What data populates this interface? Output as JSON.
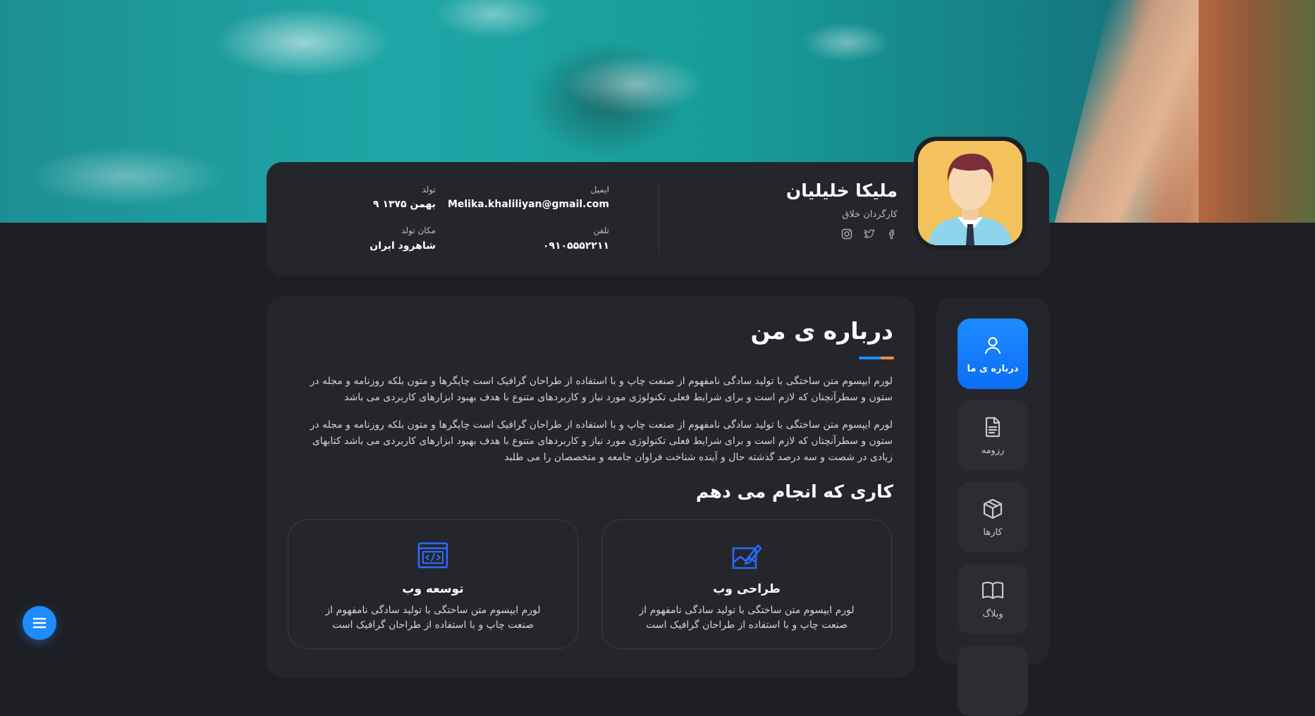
{
  "profile": {
    "name": "ملیکا خلیلیان",
    "role": "کارگردان خلاق",
    "socials": [
      "facebook-icon",
      "twitter-icon",
      "instagram-icon"
    ]
  },
  "info": {
    "email_label": "ایمیل",
    "email_value": "Melika.khaliliyan@gmail.com",
    "birth_label": "تولد",
    "birth_value": "۹ بهمن ۱۳۷۵",
    "phone_label": "تلفن",
    "phone_value": "۰۹۱۰۵۵۵۲۲۱۱",
    "birthplace_label": "مکان تولد",
    "birthplace_value": "شاهرود ایران"
  },
  "nav": {
    "items": [
      {
        "label": "درباره ی ما",
        "icon": "user-icon"
      },
      {
        "label": "رزومه",
        "icon": "document-icon"
      },
      {
        "label": "کارها",
        "icon": "box-icon"
      },
      {
        "label": "وبلاگ",
        "icon": "book-icon"
      }
    ]
  },
  "about": {
    "title": "درباره ی من",
    "para1": "لورم ایپسوم متن ساختگی با تولید سادگی نامفهوم از صنعت چاپ و با استفاده از طراحان گرافیک است چاپگرها و متون بلکه روزنامه و مجله در ستون و سطرآنچنان که لازم است و برای شرایط فعلی تکنولوژی مورد نیاز و کاربردهای متنوع با هدف بهبود ابزارهای کاربردی می باشد",
    "para2": "لورم ایپسوم متن ساختگی با تولید سادگی نامفهوم از صنعت چاپ و با استفاده از طراحان گرافیک است چاپگرها و متون بلکه روزنامه و مجله در ستون و سطرآنچنان که لازم است و برای شرایط فعلی تکنولوژی مورد نیاز و کاربردهای متنوع با هدف بهبود ابزارهای کاربردی می باشد کتابهای زیادی در شصت و سه درصد گذشته حال و آینده شناخت فراوان جامعه و متخصصان را می طلبد"
  },
  "services": {
    "title": "کاری که انجام می دهم",
    "items": [
      {
        "title": "طراحی وب",
        "desc": "لورم ایپسوم متن ساختگی با تولید سادگی نامفهوم از صنعت چاپ و با استفاده از طراحان گرافیک است",
        "icon": "design-icon"
      },
      {
        "title": "توسعه وب",
        "desc": "لورم ایپسوم متن ساختگی با تولید سادگی نامفهوم از صنعت چاپ و با استفاده از طراحان گرافیک است",
        "icon": "code-window-icon"
      }
    ]
  },
  "colors": {
    "accent": "#1e8bff",
    "accent_secondary": "#f08c42",
    "background": "#1e1f25",
    "card": "#25262c"
  }
}
